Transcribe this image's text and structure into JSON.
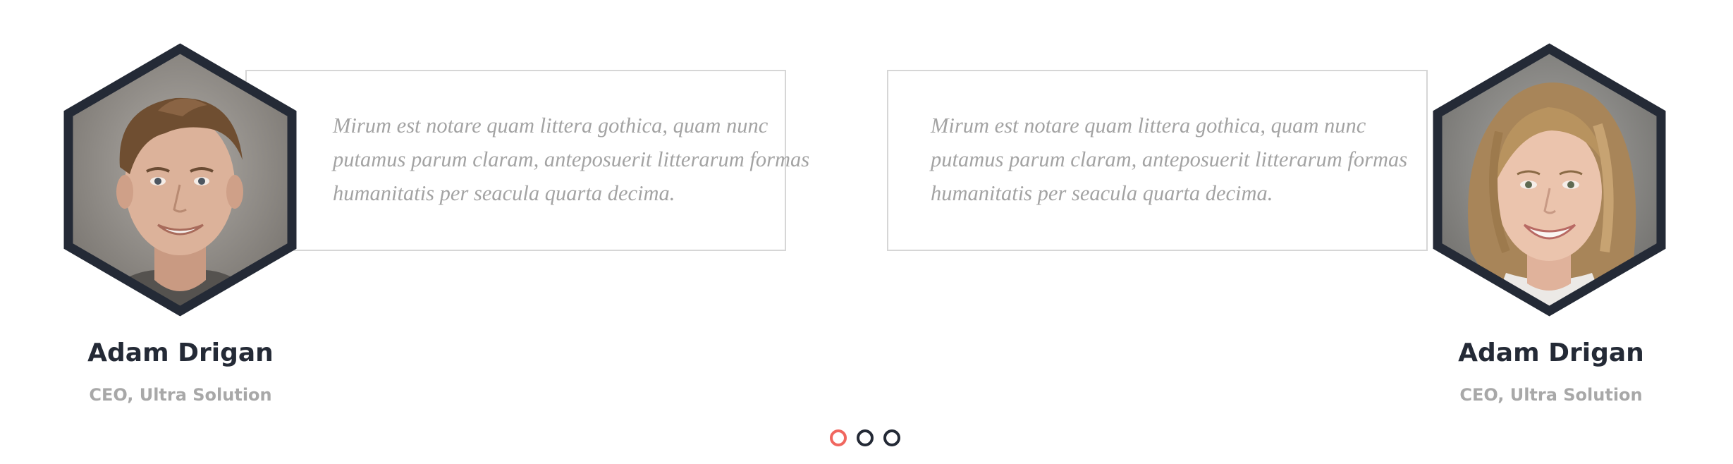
{
  "testimonials": [
    {
      "quote": "Mirum est notare quam littera gothica, quam nunc putamus parum claram, anteposuerit litterarum formas humanitatis per seacula quarta decima.",
      "name": "Adam Drigan",
      "role": "CEO, Ultra Solution",
      "photo": "male-portrait"
    },
    {
      "quote": "Mirum est notare quam littera gothica, quam nunc putamus parum claram, anteposuerit litterarum formas humanitatis per seacula quarta decima.",
      "name": "Adam Drigan",
      "role": "CEO, Ultra Solution",
      "photo": "female-portrait"
    }
  ],
  "pager": {
    "count": 3,
    "active_index": 0,
    "active_color": "#f0675f",
    "inactive_color": "#242a36"
  },
  "colors": {
    "hex_border": "#242a36",
    "quote_text": "#a3a3a3",
    "name_text": "#242a36",
    "role_text": "#a8a8a8",
    "box_border": "#d6d6d6"
  }
}
